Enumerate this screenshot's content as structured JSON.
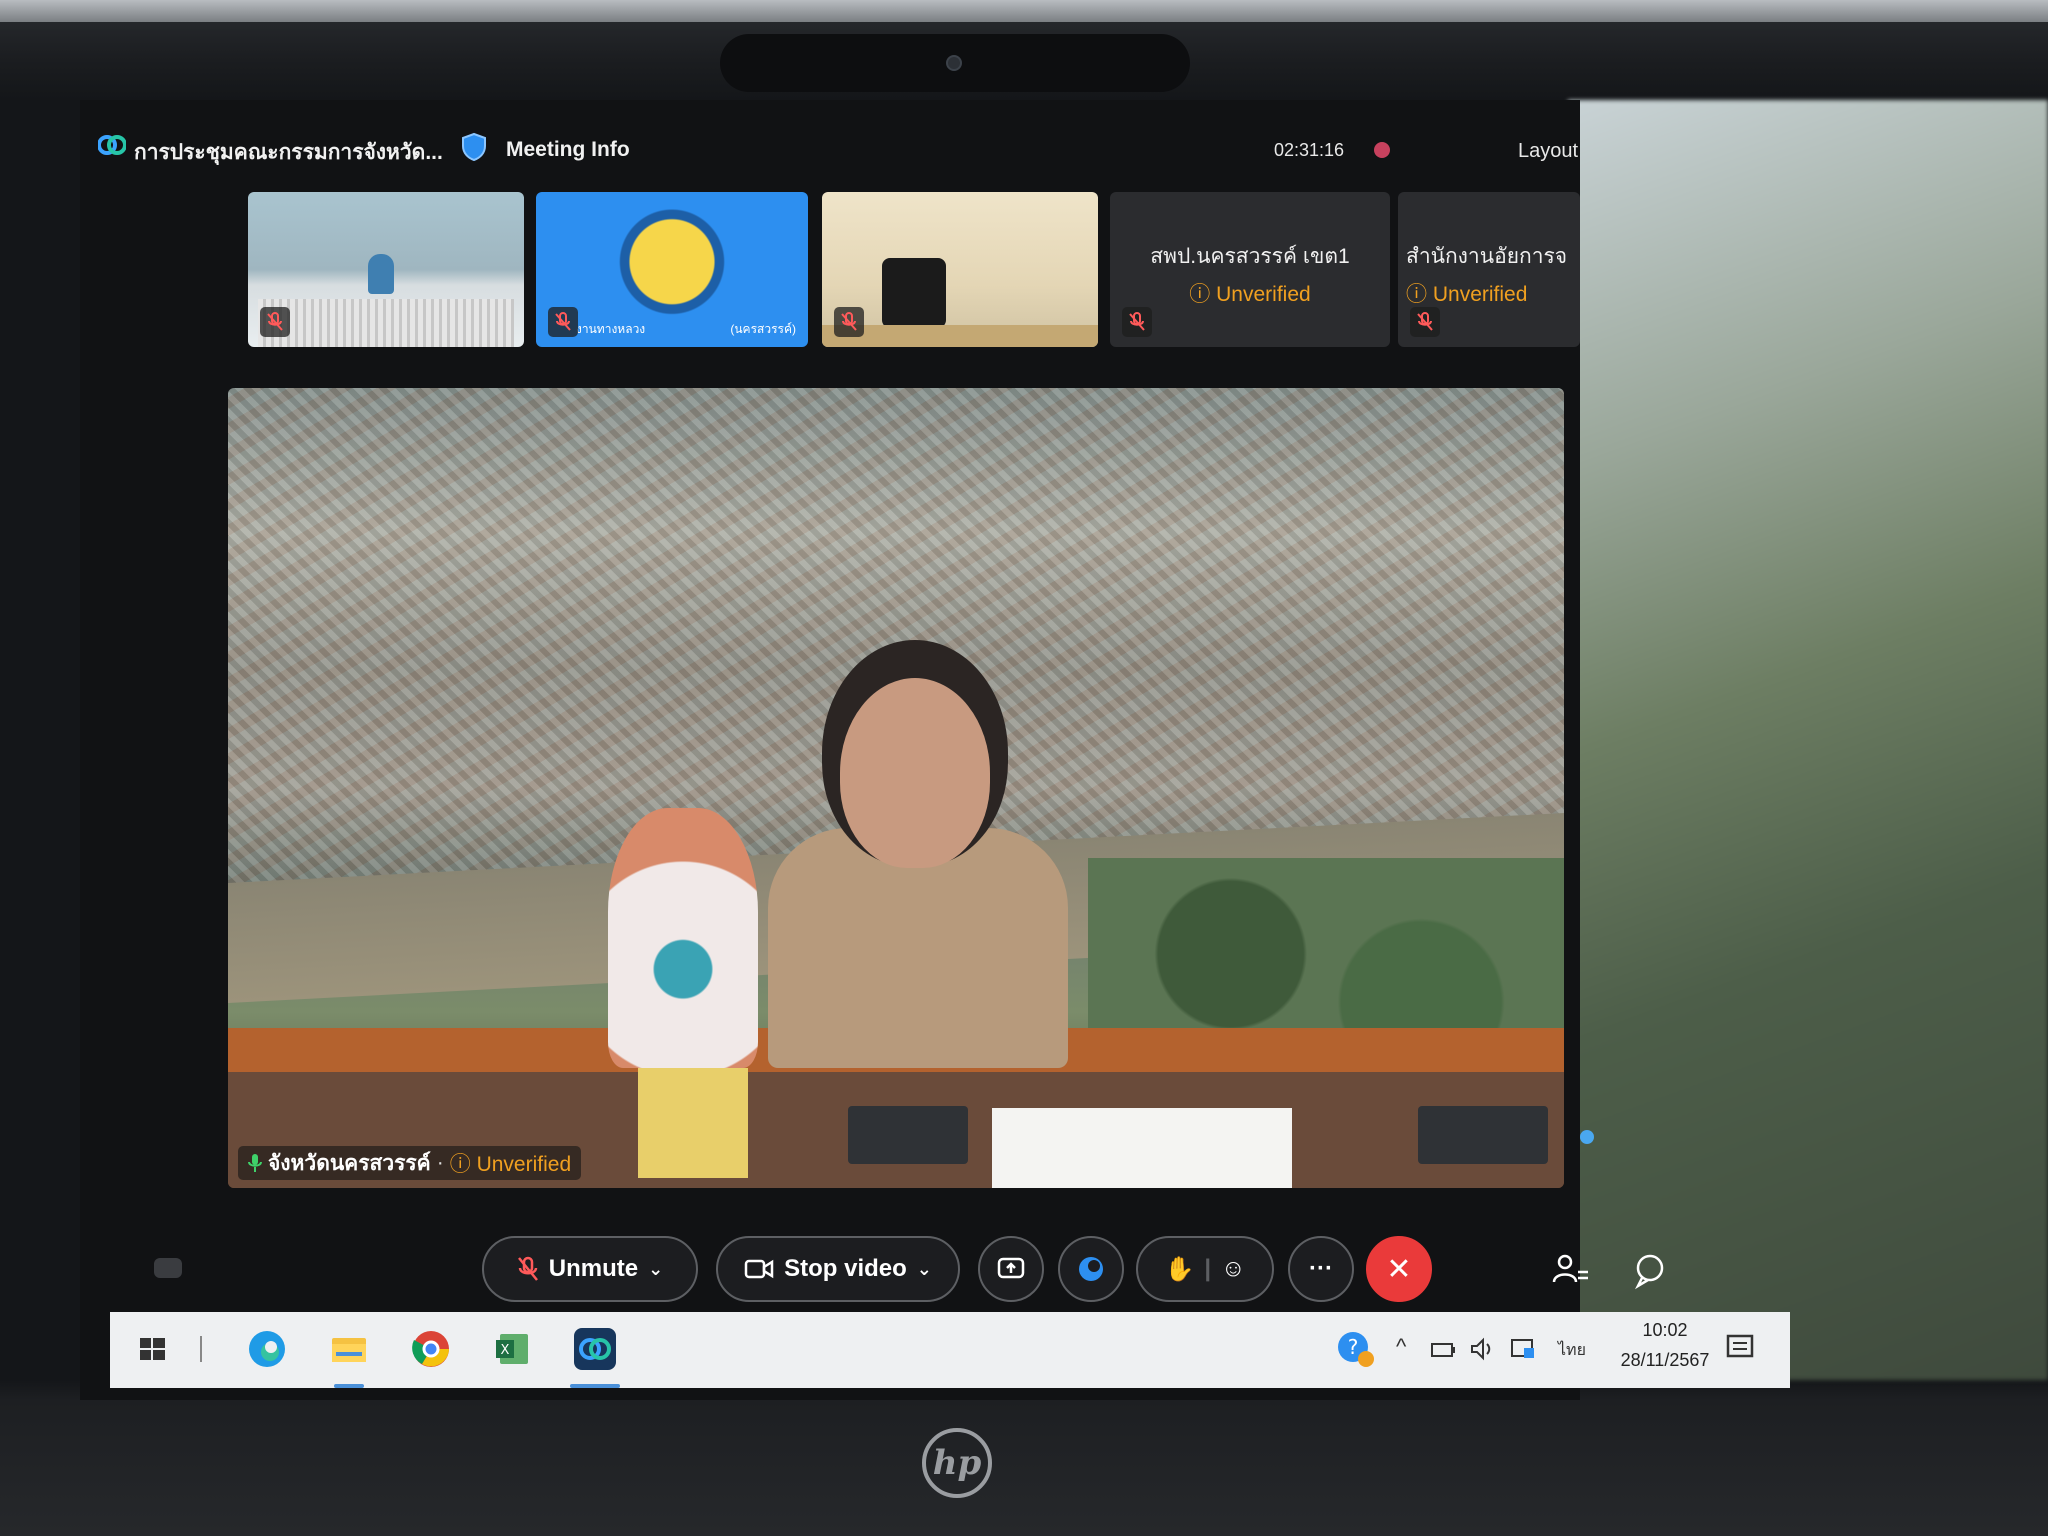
{
  "app": {
    "meeting_title": "การประชุมคณะกรรมการจังหวัด...",
    "meeting_info_label": "Meeting Info",
    "timer": "02:31:16",
    "layout_label": "Layout"
  },
  "thumbnails": [
    {
      "type": "video",
      "muted": true
    },
    {
      "type": "video",
      "muted": true,
      "caption_left": "งานทางหลวง",
      "caption_right": "(นครสวรรค์)"
    },
    {
      "type": "video",
      "muted": true
    },
    {
      "type": "name",
      "name": "สพป.นครสวรรค์ เขต1",
      "status": "Unverified",
      "muted": true
    },
    {
      "type": "name",
      "name": "สำนักงานอัยการจ",
      "status": "Unverified",
      "muted": true
    }
  ],
  "main_video": {
    "participant_name": "จังหวัดนครสวรรค์",
    "separator": "·",
    "status": "Unverified"
  },
  "controls": {
    "unmute_label": "Unmute",
    "stop_video_label": "Stop video",
    "more_label": "···"
  },
  "taskbar": {
    "apps": [
      "start-icon",
      "edge-icon",
      "file-explorer-icon",
      "chrome-icon",
      "excel-icon",
      "webex-icon"
    ],
    "language": "ไทย",
    "time": "10:02",
    "date": "28/11/2567"
  },
  "colors": {
    "unverified": "#f0a020",
    "end_call": "#ea3a3a",
    "accent_blue": "#2d8ff0"
  }
}
